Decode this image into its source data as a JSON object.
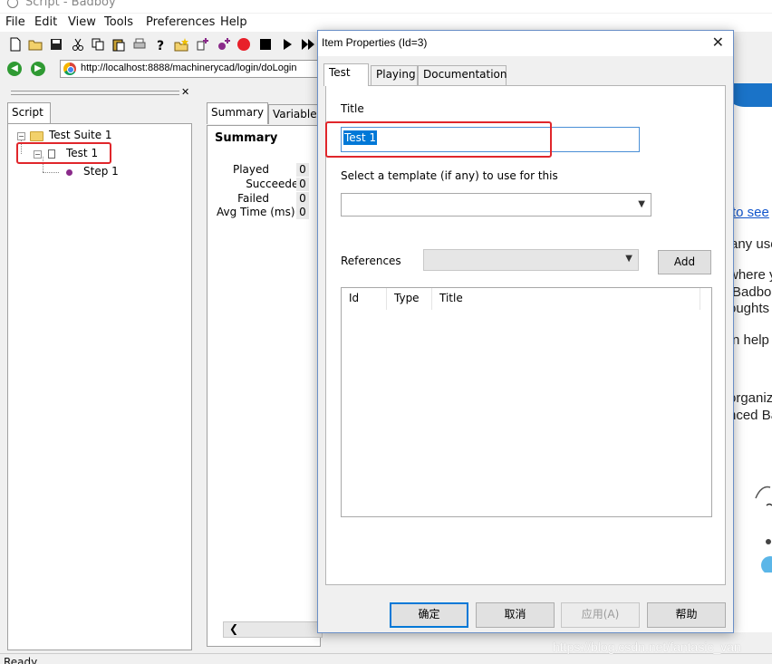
{
  "app": {
    "title": "Script - Badboy"
  },
  "menu": [
    {
      "label": "File"
    },
    {
      "label": "Edit"
    },
    {
      "label": "View"
    },
    {
      "label": "Tools"
    },
    {
      "label": "Preferences"
    },
    {
      "label": "Help"
    }
  ],
  "address": {
    "url": "http://localhost:8888/machinerycad/login/doLogin"
  },
  "script_panel": {
    "tab_label": "Script",
    "tree": {
      "suite": "Test Suite 1",
      "test": "Test 1",
      "step": "Step 1"
    }
  },
  "summary_panel": {
    "tabs": [
      "Summary",
      "Variables"
    ],
    "heading": "Summary",
    "rows": [
      {
        "label": "Played",
        "value": "0"
      },
      {
        "label": "Succeeded",
        "value": "0"
      },
      {
        "label": "Failed",
        "value": "0"
      },
      {
        "label": "Avg Time (ms)",
        "value": "0"
      }
    ]
  },
  "browser": {
    "link_text": "to see",
    "lines": [
      "any use",
      "where y",
      "Badbo",
      "oughts",
      "n help",
      "organiz",
      "nced Ba"
    ]
  },
  "dialog": {
    "title": "Item Properties (Id=3)",
    "tabs": [
      "Test",
      "Playing",
      "Documentation"
    ],
    "title_label": "Title",
    "title_value": "Test 1",
    "template_label": "Select a template (if any) to use for this",
    "template_value": "",
    "references_label": "References",
    "references_value": "",
    "add_button": "Add",
    "columns": [
      "Id",
      "Type",
      "Title"
    ],
    "buttons": {
      "ok": "确定",
      "cancel": "取消",
      "apply": "应用(A)",
      "help": "帮助"
    }
  },
  "status": {
    "text": "Ready"
  },
  "watermark": "https://blog.csdn.net/fantasic_van",
  "colors": {
    "highlight_box": "#e0262b",
    "selection": "#0078d7",
    "accent_blue": "#1a73c8"
  }
}
